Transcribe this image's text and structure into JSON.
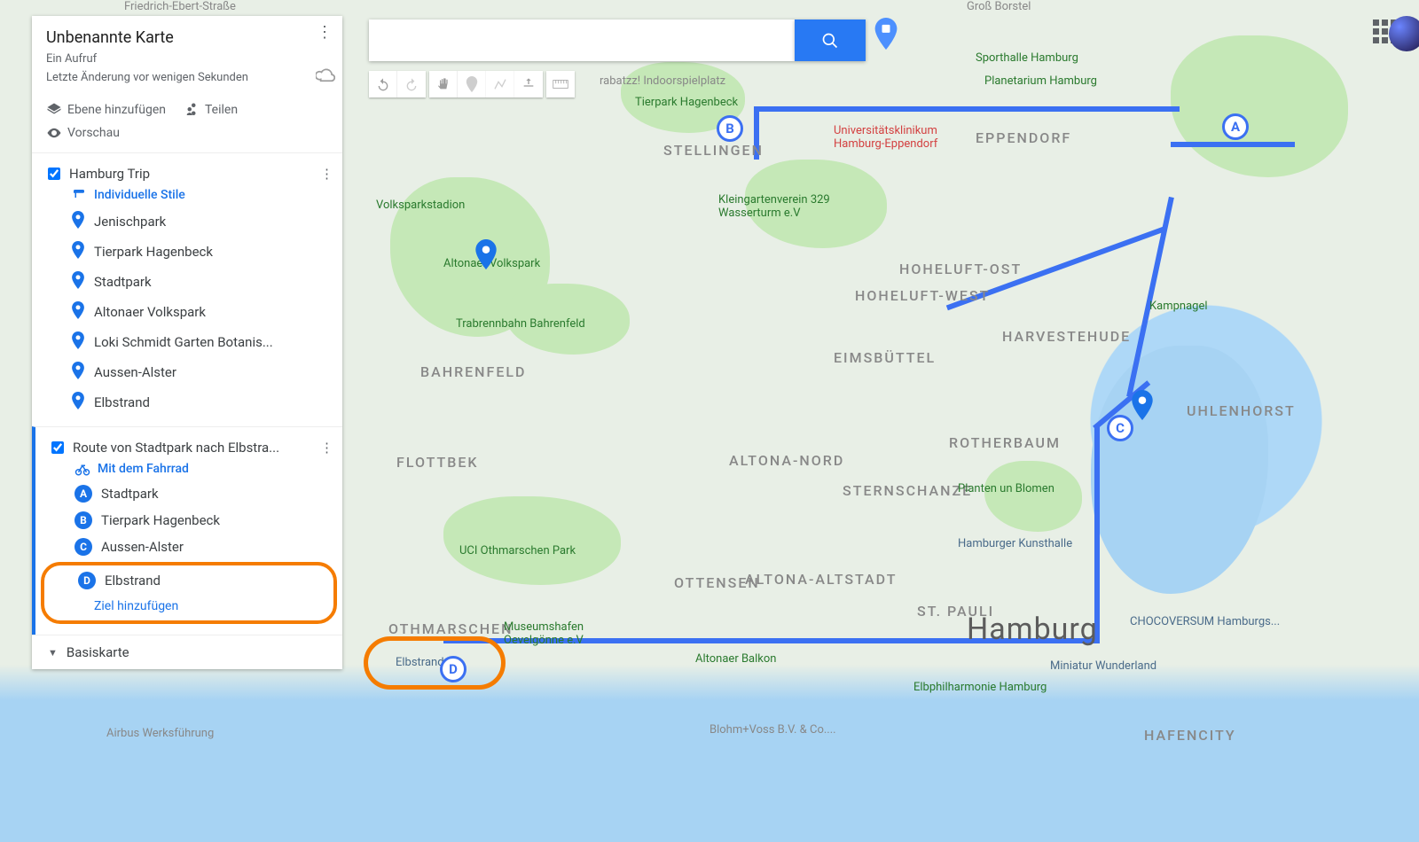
{
  "header": {
    "title": "Unbenannte Karte",
    "views": "Ein Aufruf",
    "last_edit": "Letzte Änderung vor wenigen Sekunden"
  },
  "actions": {
    "add_layer": "Ebene hinzufügen",
    "share": "Teilen",
    "preview": "Vorschau"
  },
  "layer1": {
    "name": "Hamburg Trip",
    "style_label": "Individuelle Stile",
    "places": [
      "Jenischpark",
      "Tierpark Hagenbeck",
      "Stadtpark",
      "Altonaer Volkspark",
      "Loki Schmidt Garten Botanis...",
      "Aussen-Alster",
      "Elbstrand"
    ]
  },
  "layer2": {
    "name": "Route von Stadtpark nach Elbstra...",
    "mode_label": "Mit dem Fahrrad",
    "stops": [
      {
        "letter": "A",
        "name": "Stadtpark"
      },
      {
        "letter": "B",
        "name": "Tierpark Hagenbeck"
      },
      {
        "letter": "C",
        "name": "Aussen-Alster"
      },
      {
        "letter": "D",
        "name": "Elbstrand"
      }
    ],
    "add_destination": "Ziel hinzufügen"
  },
  "basemap_label": "Basiskarte",
  "search": {
    "placeholder": ""
  },
  "map_labels": {
    "hamburg": "Hamburg",
    "altona": "ALTONA-ALTSTADT",
    "bahrenfeld": "BAHRENFELD",
    "flottbek": "FLOTTBEK",
    "ottensen": "OTTENSEN",
    "stellingen": "STELLINGEN",
    "othmarschen": "OTHMARSCHEN",
    "eimsbuettel": "EIMSBÜTTEL",
    "stpauli": "ST. PAULI",
    "altona_nord": "ALTONA-NORD",
    "harvestehude": "HARVESTEHUDE",
    "sternschanze": "STERNSCHANZE",
    "rotherbaum": "ROTHERBAUM",
    "hoheluft_ost": "HOHELUFT-OST",
    "hoheluft_west": "HOHELUFT-WEST",
    "eppendorf": "EPPENDORF",
    "uhlenhorst": "UHLENHORST",
    "hafencity": "HAFENCITY"
  },
  "pois": {
    "tierpark": "Tierpark Hagenbeck",
    "indoorspiel": "rabatzz! Indoorspielplatz",
    "planetarium": "Planetarium Hamburg",
    "sporthalle": "Sporthalle Hamburg",
    "uke": "Universitätsklinikum Hamburg-Eppendorf",
    "volksparkstadion": "Volksparkstadion",
    "altonaer_vp": "Altonaer Volkspark",
    "trabrennbahn": "Trabrennbahn Bahrenfeld",
    "kleingarten": "Kleingartenverein 329 Wasserturm e.V",
    "uci": "UCI Othmarschen Park",
    "planten": "Planten un Blomen",
    "kunsthalle": "Hamburger Kunsthalle",
    "elbphil": "Elbphilharmonie Hamburg",
    "miniatur": "Miniatur Wunderland",
    "chocoversum": "CHOCOVERSUM Hamburgs...",
    "museumshafen": "Museumshafen Oevelgönne e.V",
    "altonaer_balkon": "Altonaer Balkon",
    "kampnagel": "Kampnagel",
    "elbstrand": "Elbstrand",
    "blohm": "Blohm+Voss B.V. & Co....",
    "airbus": "Airbus Werksführung",
    "gross_borstel": "Groß Borstel",
    "friedrich": "Friedrich-Ebert-Straße"
  }
}
